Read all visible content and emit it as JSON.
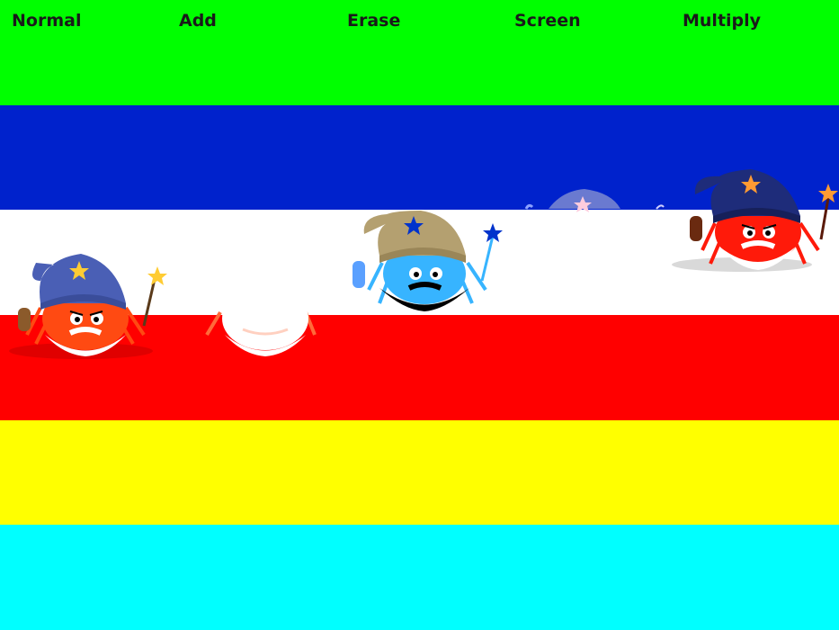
{
  "bands": [
    {
      "color": "#00ff00"
    },
    {
      "color": "#0022cc"
    },
    {
      "color": "#ffffff"
    },
    {
      "color": "#ff0000"
    },
    {
      "color": "#ffff00"
    },
    {
      "color": "#00ffff"
    }
  ],
  "blend_modes": [
    {
      "label": "Normal"
    },
    {
      "label": "Add"
    },
    {
      "label": "Erase"
    },
    {
      "label": "Screen"
    },
    {
      "label": "Multiply"
    }
  ],
  "sprites": [
    {
      "name": "wizard-crab-normal",
      "blend": "Normal",
      "body_color": "#ff4a12",
      "hat_color": "#4a5fb5",
      "beard_color": "#ffffff",
      "star_color": "#ffcc33"
    },
    {
      "name": "wizard-crab-add",
      "blend": "Add",
      "body_color": "#ffffff",
      "hat_color": "#ffffff",
      "beard_color": "#ffffff",
      "star_color": "#ffffff"
    },
    {
      "name": "wizard-crab-erase",
      "blend": "Erase",
      "body_color": "#37b4ff",
      "hat_color": "#b4a070",
      "beard_color": "#000000",
      "star_color": "#0033cc"
    },
    {
      "name": "wizard-crab-screen",
      "blend": "Screen",
      "body_color": "#ffffff",
      "hat_color": "#6a7ad0",
      "beard_color": "#ffffff",
      "star_color": "#ffccdd"
    },
    {
      "name": "wizard-crab-multiply",
      "blend": "Multiply",
      "body_color": "#ff1a0a",
      "hat_color": "#1e2c7a",
      "beard_color": "#ffffff",
      "star_color": "#ff9a33"
    }
  ]
}
